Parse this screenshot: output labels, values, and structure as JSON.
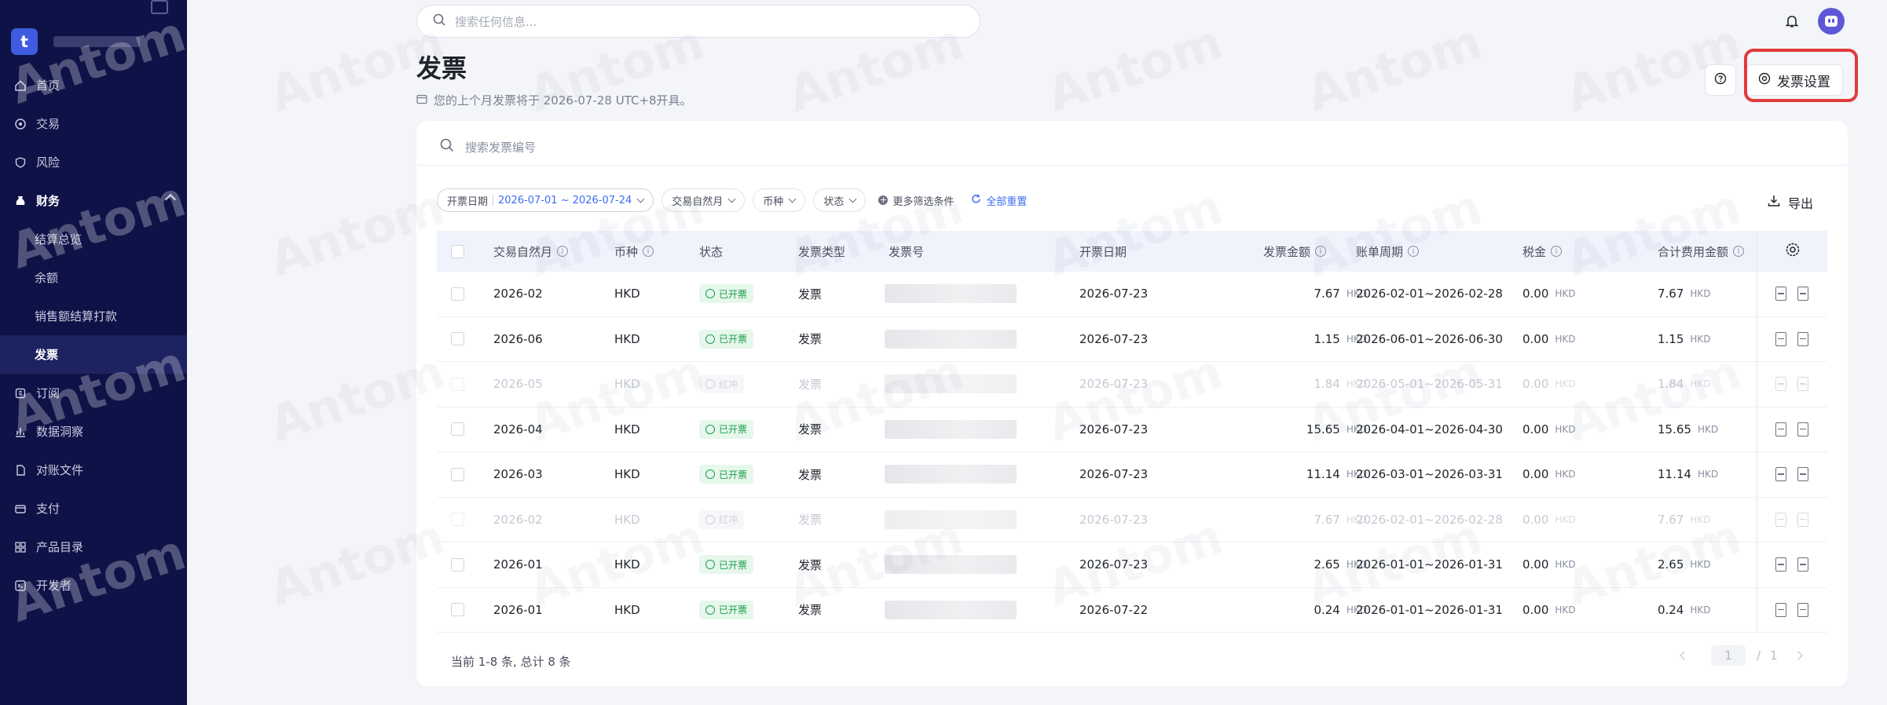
{
  "sidebar": {
    "logo_letter": "t",
    "items": [
      {
        "label": "首页",
        "icon": "home-icon"
      },
      {
        "label": "交易",
        "icon": "transaction-icon"
      },
      {
        "label": "风险",
        "icon": "shield-icon"
      },
      {
        "label": "财务",
        "icon": "finance-icon"
      },
      {
        "label": "结算总览"
      },
      {
        "label": "余额"
      },
      {
        "label": "销售额结算打款"
      },
      {
        "label": "发票"
      },
      {
        "label": "订阅",
        "icon": "subscription-icon"
      },
      {
        "label": "数据洞察",
        "icon": "chart-icon"
      },
      {
        "label": "对账文件",
        "icon": "file-icon"
      },
      {
        "label": "支付",
        "icon": "payment-icon"
      },
      {
        "label": "产品目录",
        "icon": "catalog-icon"
      },
      {
        "label": "开发者",
        "icon": "code-icon"
      }
    ],
    "watermark": "Antom"
  },
  "topbar": {
    "search_placeholder": "搜索任何信息..."
  },
  "page": {
    "title": "发票",
    "notice": "您的上个月发票将于 2026-07-28 UTC+8开具。",
    "help_icon": "question-icon",
    "settings_label": "发票设置",
    "highlight_color": "#e23a3a"
  },
  "card": {
    "search_placeholder": "搜索发票编号",
    "filters": {
      "date_label": "开票日期",
      "date_value": "2026-07-01 ~ 2026-07-24",
      "month_label": "交易自然月",
      "currency_label": "币种",
      "status_label": "状态",
      "more_label": "更多筛选条件",
      "reset_label": "全部重置"
    },
    "export_label": "导出",
    "columns": [
      "交易自然月",
      "币种",
      "状态",
      "发票类型",
      "发票号",
      "开票日期",
      "发票金额",
      "账单周期",
      "税金",
      "合计费用金额"
    ],
    "rows": [
      {
        "month": "2026-02",
        "currency": "HKD",
        "status": "已开票",
        "type": "发票",
        "date": "2026-07-23",
        "amount": "7.67",
        "unit": "HKD",
        "period": "2026-02-01~2026-02-28",
        "tax": "0.00",
        "tax_unit": "HKD",
        "total": "7.67",
        "total_unit": "HKD",
        "dim": false
      },
      {
        "month": "2026-06",
        "currency": "HKD",
        "status": "已开票",
        "type": "发票",
        "date": "2026-07-23",
        "amount": "1.15",
        "unit": "HKD",
        "period": "2026-06-01~2026-06-30",
        "tax": "0.00",
        "tax_unit": "HKD",
        "total": "1.15",
        "total_unit": "HKD",
        "dim": false
      },
      {
        "month": "2026-05",
        "currency": "HKD",
        "status": "红冲",
        "type": "发票",
        "date": "2026-07-23",
        "amount": "1.84",
        "unit": "HKD",
        "period": "2026-05-01~2026-05-31",
        "tax": "0.00",
        "tax_unit": "HKD",
        "total": "1.84",
        "total_unit": "HKD",
        "dim": true
      },
      {
        "month": "2026-04",
        "currency": "HKD",
        "status": "已开票",
        "type": "发票",
        "date": "2026-07-23",
        "amount": "15.65",
        "unit": "HKD",
        "period": "2026-04-01~2026-04-30",
        "tax": "0.00",
        "tax_unit": "HKD",
        "total": "15.65",
        "total_unit": "HKD",
        "dim": false
      },
      {
        "month": "2026-03",
        "currency": "HKD",
        "status": "已开票",
        "type": "发票",
        "date": "2026-07-23",
        "amount": "11.14",
        "unit": "HKD",
        "period": "2026-03-01~2026-03-31",
        "tax": "0.00",
        "tax_unit": "HKD",
        "total": "11.14",
        "total_unit": "HKD",
        "dim": false
      },
      {
        "month": "2026-02",
        "currency": "HKD",
        "status": "红冲",
        "type": "发票",
        "date": "2026-07-23",
        "amount": "7.67",
        "unit": "HKD",
        "period": "2026-02-01~2026-02-28",
        "tax": "0.00",
        "tax_unit": "HKD",
        "total": "7.67",
        "total_unit": "HKD",
        "dim": true
      },
      {
        "month": "2026-01",
        "currency": "HKD",
        "status": "已开票",
        "type": "发票",
        "date": "2026-07-23",
        "amount": "2.65",
        "unit": "HKD",
        "period": "2026-01-01~2026-01-31",
        "tax": "0.00",
        "tax_unit": "HKD",
        "total": "2.65",
        "total_unit": "HKD",
        "dim": false
      },
      {
        "month": "2026-01",
        "currency": "HKD",
        "status": "已开票",
        "type": "发票",
        "date": "2026-07-22",
        "amount": "0.24",
        "unit": "HKD",
        "period": "2026-01-01~2026-01-31",
        "tax": "0.00",
        "tax_unit": "HKD",
        "total": "0.24",
        "total_unit": "HKD",
        "dim": false
      }
    ],
    "summary": "当前 1-8 条, 总计 8 条",
    "pager": {
      "current": "1",
      "sep": "/",
      "total": "1"
    }
  },
  "watermark": "Antom"
}
